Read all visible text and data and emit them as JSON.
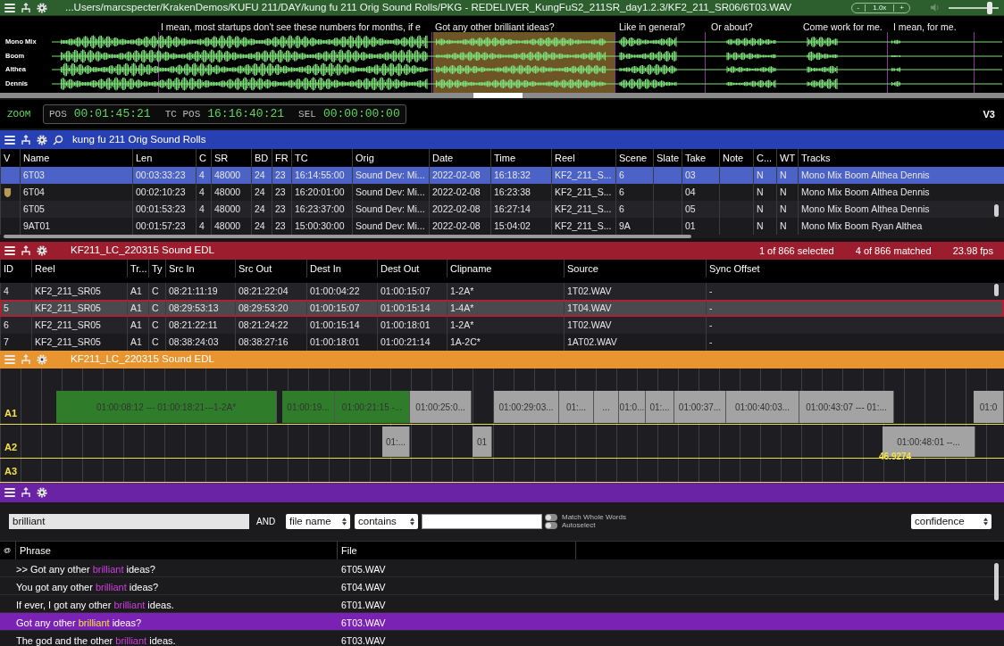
{
  "title_bar": {
    "path": "...Users/marcspecter/KrakenDemos/KUFU 211/DAY/kung fu 211 Orig Sound Rolls/PKG - REDELIVER_KungFuS2_211SR_day1.2.3/KF2_211_SR06/6T03.WAV",
    "zoom_minus": "-",
    "zoom_value": "1.0x",
    "zoom_plus": "+",
    "volume": {
      "level": 0.85
    }
  },
  "waveform": {
    "phrases": [
      "I mean, most startups don't see these numbers for months, if e",
      "Got any other brilliant ideas?",
      "Like in general?",
      "Or about?",
      "Come work for me.",
      "I mean, for me."
    ],
    "tracks": [
      "Mono Mix",
      "Boom",
      "Althea",
      "Dennis"
    ]
  },
  "transport": {
    "zoom": "ZOOM",
    "pos_label": "POS",
    "pos": "00:01:45:21",
    "tc_pos_label": "TC POS",
    "tc_pos": "16:16:40:21",
    "sel_label": "SEL",
    "sel": "00:00:00:00",
    "version": "V3"
  },
  "rolls": {
    "title": "kung fu 211 Orig Sound Rolls",
    "columns": [
      "V",
      "Name",
      "Len",
      "C",
      "SR",
      "BD",
      "FR",
      "TC",
      "Orig",
      "Date",
      "Time",
      "Reel",
      "Scene",
      "Slate",
      "Take",
      "Note",
      "C...",
      "WT",
      "Tracks"
    ],
    "rows": [
      {
        "selected": true,
        "flagged": false,
        "cells": [
          "",
          "6T03",
          "00:03:33:23",
          "4",
          "48000",
          "24",
          "23",
          "16:14:55:00",
          "Sound Dev: Mi...",
          "2022-02-08",
          "16:18:32",
          "KF2_211_S...",
          "6",
          "",
          "03",
          "",
          "N",
          "N",
          "Mono Mix Boom Althea Dennis"
        ]
      },
      {
        "selected": false,
        "flagged": true,
        "cells": [
          "",
          "6T04",
          "00:02:10:23",
          "4",
          "48000",
          "24",
          "23",
          "16:20:01:00",
          "Sound Dev: Mi...",
          "2022-02-08",
          "16:23:38",
          "KF2_211_S...",
          "6",
          "",
          "04",
          "",
          "N",
          "N",
          "Mono Mix Boom Althea Dennis"
        ]
      },
      {
        "selected": false,
        "flagged": false,
        "cells": [
          "",
          "6T05",
          "00:01:53:23",
          "4",
          "48000",
          "24",
          "23",
          "16:23:37:00",
          "Sound Dev: Mi...",
          "2022-02-08",
          "16:27:14",
          "KF2_211_S...",
          "6",
          "",
          "05",
          "",
          "N",
          "N",
          "Mono Mix Boom Althea Dennis"
        ]
      },
      {
        "selected": false,
        "flagged": false,
        "cells": [
          "",
          "9AT01",
          "00:01:57:23",
          "4",
          "48000",
          "24",
          "23",
          "15:00:30:00",
          "Sound Dev: Mi...",
          "2022-02-08",
          "15:04:02",
          "KF2_211_S...",
          "9A",
          "",
          "01",
          "",
          "N",
          "N",
          "Mono Mix Boom Ryan Althea"
        ]
      }
    ]
  },
  "edl": {
    "title": "KF211_LC_220315 Sound EDL",
    "selected_count": "1 of 866 selected",
    "matched": "4 of 866 matched",
    "fps": "23.98 fps",
    "columns": [
      "ID",
      "Reel",
      "Tr...",
      "Ty",
      "Src In",
      "Src Out",
      "Dest In",
      "Dest Out",
      "Clipname",
      "Source",
      "Sync Offset"
    ],
    "rows": [
      {
        "selected": false,
        "cells": [
          "4",
          "KF2_211_SR05",
          "A1",
          "C",
          "08:21:11:19",
          "08:21:22:04",
          "01:00:04:22",
          "01:00:15:07",
          "1-2A*",
          "1T02.WAV",
          "-"
        ]
      },
      {
        "selected": true,
        "cells": [
          "5",
          "KF2_211_SR05",
          "A1",
          "C",
          "08:29:53:13",
          "08:29:53:20",
          "01:00:15:07",
          "01:00:15:14",
          "1-4A*",
          "1T04.WAV",
          "-"
        ]
      },
      {
        "selected": false,
        "cells": [
          "6",
          "KF2_211_SR05",
          "A1",
          "C",
          "08:21:22:11",
          "08:21:24:22",
          "01:00:15:14",
          "01:00:18:01",
          "1-2A*",
          "1T02.WAV",
          "-"
        ]
      },
      {
        "selected": false,
        "cells": [
          "7",
          "KF2_211_SR05",
          "A1",
          "C",
          "08:38:24:03",
          "08:38:27:16",
          "01:00:18:01",
          "01:00:21:14",
          "1A-2C*",
          "1AT02.WAV",
          "-"
        ]
      }
    ]
  },
  "timeline": {
    "title": "KF211_LC_220315 Sound EDL",
    "marker": "46.9274",
    "tracks": [
      {
        "name": "A1",
        "clips": [
          {
            "label": "01:00:08:12 --- 01:00:18:21---1-2A*",
            "color": "#2f7d2b"
          },
          {
            "label": "01:00:19...",
            "color": "#2f7d2b"
          },
          {
            "label": "01:00:21:15 -...",
            "color": "#2f7d2b"
          },
          {
            "label": "01:00:25:0...",
            "color": "#a3a3a3"
          },
          {
            "label": "01:00:29:03...",
            "color": "#a3a3a3"
          },
          {
            "label": "01:...",
            "color": "#a3a3a3"
          },
          {
            "label": "...",
            "color": "#a3a3a3"
          },
          {
            "label": "01:0...",
            "color": "#a3a3a3"
          },
          {
            "label": "01:...",
            "color": "#a3a3a3"
          },
          {
            "label": "01:00:37...",
            "color": "#a3a3a3"
          },
          {
            "label": "01:00:40:03...",
            "color": "#a3a3a3"
          },
          {
            "label": "01:00:43:07 --- 01:...",
            "color": "#a3a3a3"
          },
          {
            "label": "01:0",
            "color": "#a3a3a3"
          }
        ]
      },
      {
        "name": "A2",
        "clips": [
          {
            "label": "01:...",
            "color": "#a3a3a3"
          },
          {
            "label": "01",
            "color": "#a3a3a3"
          },
          {
            "label": "01:00:48:01 --...",
            "color": "#a3a3a3"
          }
        ]
      },
      {
        "name": "A3"
      }
    ]
  },
  "search": {
    "query": "brilliant",
    "operator": "AND",
    "field": "file name",
    "condition": "contains",
    "match_whole_words": {
      "label": "Match Whole Words",
      "on": false
    },
    "autoselect": {
      "label": "Autoselect",
      "on": false
    },
    "sort": "confidence",
    "columns": [
      "@",
      "Phrase",
      "File"
    ],
    "rows": [
      {
        "selected": false,
        "before": ">> Got any other ",
        "match": "brilliant",
        "after": " ideas?",
        "file": "6T05.WAV"
      },
      {
        "selected": false,
        "before": "You got any other ",
        "match": "brilliant",
        "after": " ideas?",
        "file": "6T04.WAV"
      },
      {
        "selected": false,
        "before": "If ever, I got any other ",
        "match": "brilliant",
        "after": " ideas.",
        "file": "6T01.WAV"
      },
      {
        "selected": true,
        "before": "Got any other ",
        "match": "brilliant",
        "after": " ideas?",
        "file": "6T03.WAV"
      },
      {
        "selected": false,
        "before": "The god and the other ",
        "match": "brilliant",
        "after": " ideas.",
        "file": "6T03.WAV"
      }
    ]
  }
}
